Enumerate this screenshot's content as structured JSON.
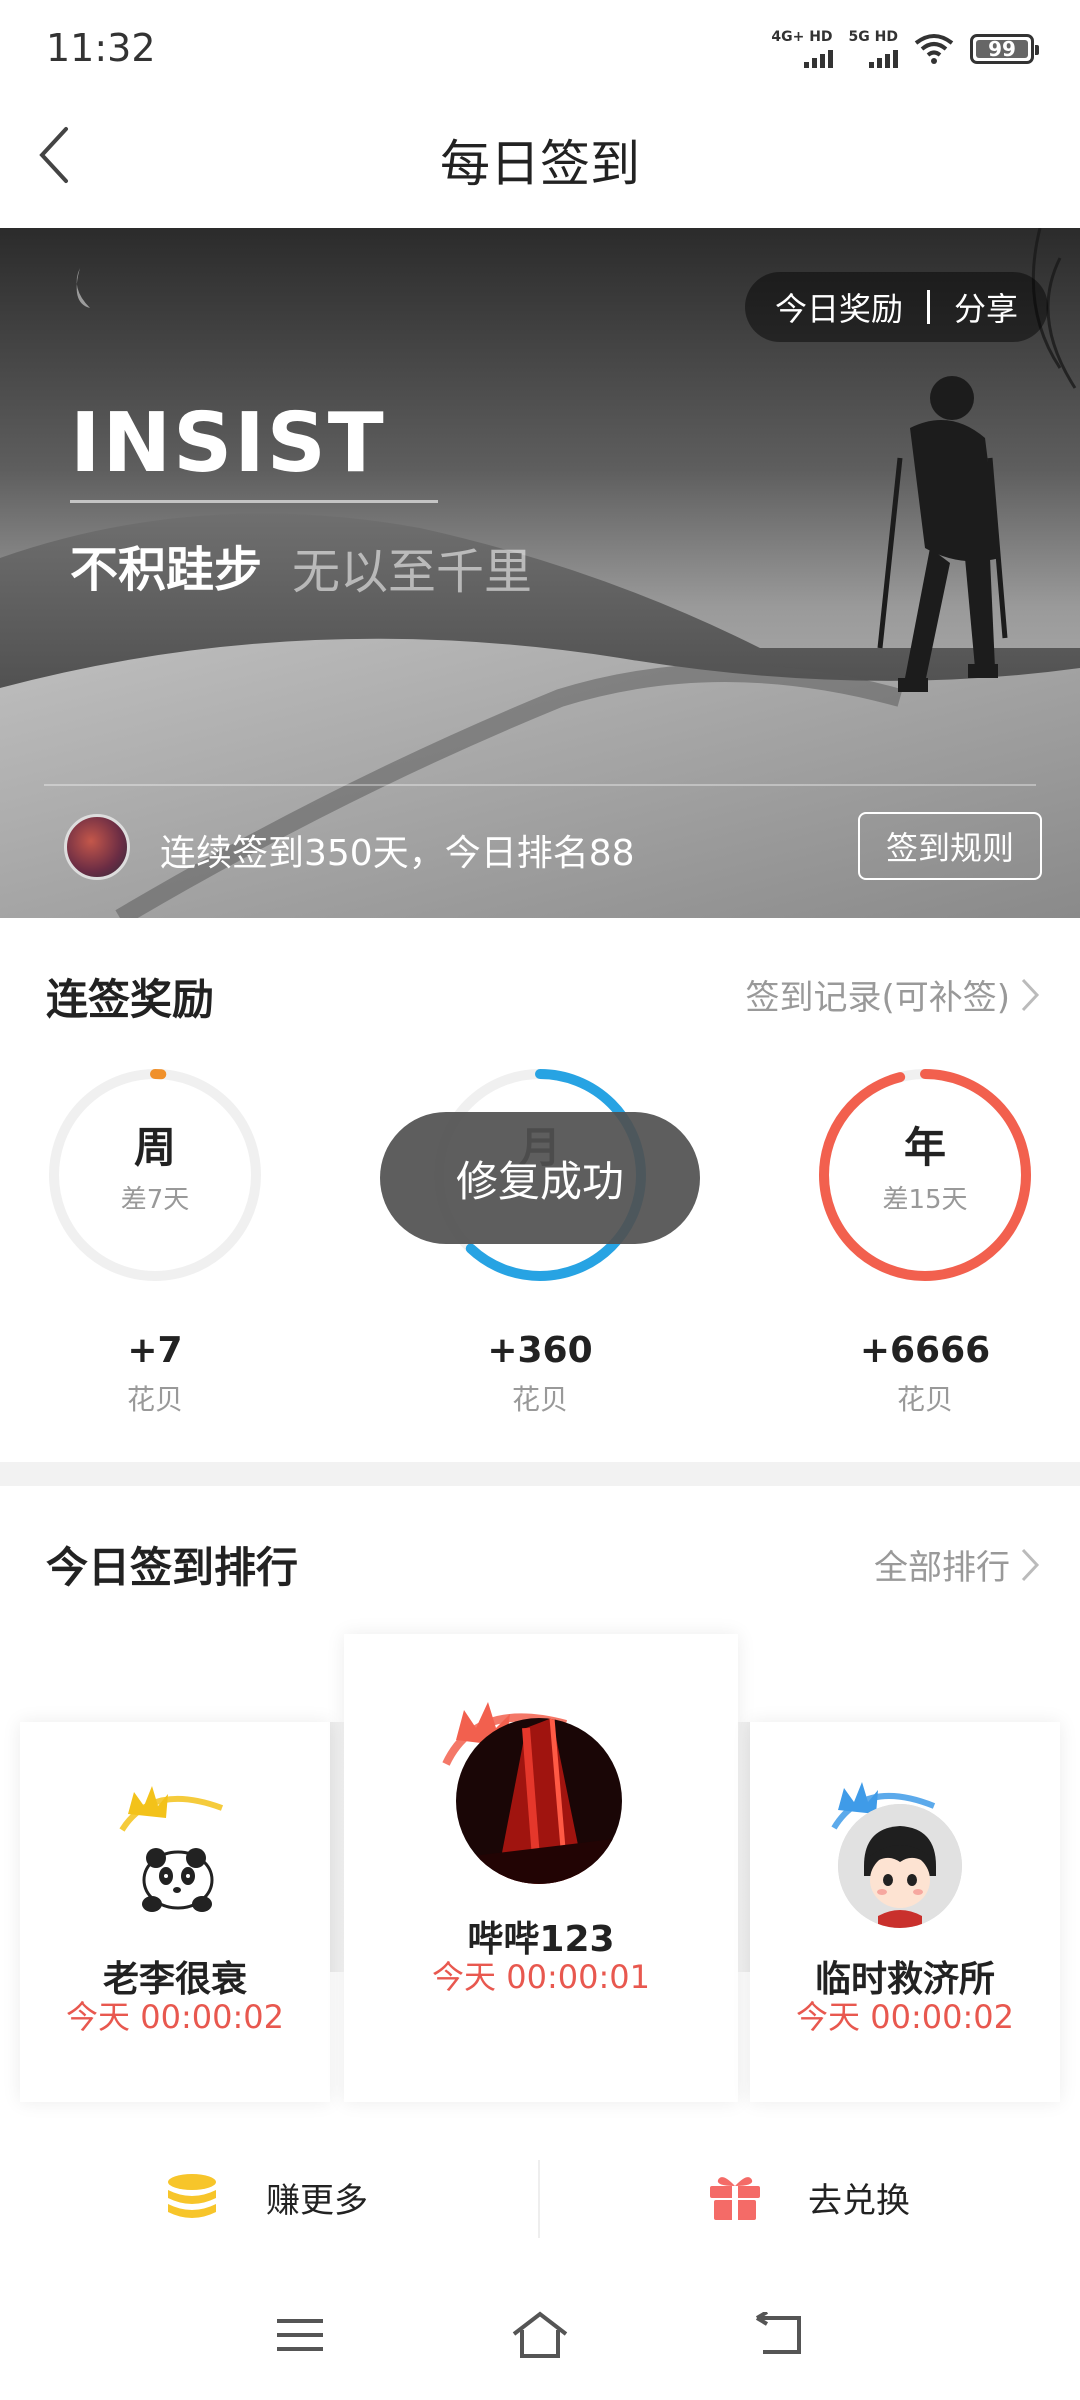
{
  "status_bar": {
    "time": "11:32",
    "signal_1": "4G+ HD",
    "signal_2": "5G HD",
    "battery": "99"
  },
  "header": {
    "title": "每日签到",
    "back_icon": "chevron-left-icon"
  },
  "banner": {
    "today_reward": "今日奖励",
    "share": "分享",
    "headline": "INSIST",
    "motto_main": "不积跬步",
    "motto_sub": "无以至千里",
    "streak_text": "连续签到350天，今日排名88",
    "rules_button": "签到规则"
  },
  "streak_rewards": {
    "title": "连签奖励",
    "record_link": "签到记录(可补签)",
    "items": [
      {
        "period": "周",
        "remaining": "差7天",
        "reward": "+7",
        "unit": "花贝",
        "progress": 0.01,
        "color": "#f0902a"
      },
      {
        "period": "月",
        "remaining": "",
        "reward": "+360",
        "unit": "花贝",
        "progress": 0.62,
        "color": "#27a3e3"
      },
      {
        "period": "年",
        "remaining": "差15天",
        "reward": "+6666",
        "unit": "花贝",
        "progress": 0.96,
        "color": "#f2604e"
      }
    ]
  },
  "toast": {
    "message": "修复成功"
  },
  "ranking": {
    "title": "今日签到排行",
    "all_link": "全部排行",
    "entries": [
      {
        "name": "老李很衰",
        "time": "今天 00:00:02",
        "rank": 2,
        "crown_color": "#f3c21a"
      },
      {
        "name": "哔哔123",
        "time": "今天 00:00:01",
        "rank": 1,
        "crown_color": "#f2604e"
      },
      {
        "name": "临时救济所",
        "time": "今天 00:00:02",
        "rank": 3,
        "crown_color": "#3f9be8"
      }
    ]
  },
  "actions": {
    "earn_more": "赚更多",
    "redeem": "去兑换"
  },
  "colors": {
    "accent_red": "#e8584f",
    "earn_icon": "#f7c52a",
    "redeem_icon": "#f46b67"
  }
}
